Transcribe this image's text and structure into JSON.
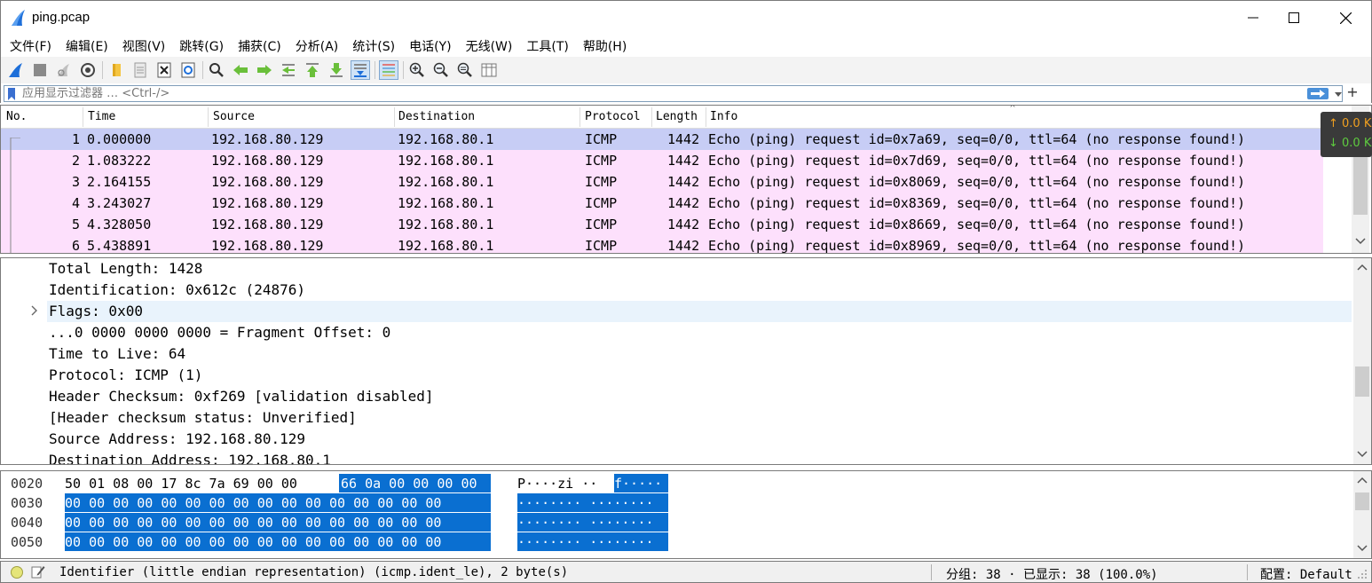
{
  "window": {
    "title": "ping.pcap",
    "app_icon": "wireshark-fin-icon",
    "controls": [
      "minimize-icon",
      "maximize-icon",
      "close-icon"
    ]
  },
  "menu": [
    "文件(F)",
    "编辑(E)",
    "视图(V)",
    "跳转(G)",
    "捕获(C)",
    "分析(A)",
    "统计(S)",
    "电话(Y)",
    "无线(W)",
    "工具(T)",
    "帮助(H)"
  ],
  "toolbar": {
    "icons": [
      "start-capture-icon",
      "stop-capture-icon",
      "restart-capture-icon",
      "capture-options-icon",
      "open-file-icon",
      "save-file-icon",
      "close-file-icon",
      "reload-file-icon",
      "find-packet-icon",
      "go-back-icon",
      "go-forward-icon",
      "go-to-packet-icon",
      "go-first-icon",
      "go-last-icon",
      "auto-scroll-icon",
      "colorize-icon",
      "zoom-in-icon",
      "zoom-out-icon",
      "zoom-normal-icon",
      "resize-columns-icon"
    ]
  },
  "filter": {
    "placeholder": "应用显示过滤器 … <Ctrl-/>"
  },
  "packet_list": {
    "columns": [
      "No.",
      "Time",
      "Source",
      "Destination",
      "Protocol",
      "Length",
      "Info"
    ],
    "rows": [
      {
        "no": "1",
        "time": "0.000000",
        "src": "192.168.80.129",
        "dst": "192.168.80.1",
        "proto": "ICMP",
        "len": "1442",
        "info": "Echo (ping) request  id=0x7a69, seq=0/0, ttl=64 (no response found!)"
      },
      {
        "no": "2",
        "time": "1.083222",
        "src": "192.168.80.129",
        "dst": "192.168.80.1",
        "proto": "ICMP",
        "len": "1442",
        "info": "Echo (ping) request  id=0x7d69, seq=0/0, ttl=64 (no response found!)"
      },
      {
        "no": "3",
        "time": "2.164155",
        "src": "192.168.80.129",
        "dst": "192.168.80.1",
        "proto": "ICMP",
        "len": "1442",
        "info": "Echo (ping) request  id=0x8069, seq=0/0, ttl=64 (no response found!)"
      },
      {
        "no": "4",
        "time": "3.243027",
        "src": "192.168.80.129",
        "dst": "192.168.80.1",
        "proto": "ICMP",
        "len": "1442",
        "info": "Echo (ping) request  id=0x8369, seq=0/0, ttl=64 (no response found!)"
      },
      {
        "no": "5",
        "time": "4.328050",
        "src": "192.168.80.129",
        "dst": "192.168.80.1",
        "proto": "ICMP",
        "len": "1442",
        "info": "Echo (ping) request  id=0x8669, seq=0/0, ttl=64 (no response found!)"
      },
      {
        "no": "6",
        "time": "5.438891",
        "src": "192.168.80.129",
        "dst": "192.168.80.1",
        "proto": "ICMP",
        "len": "1442",
        "info": "Echo (ping) request  id=0x8969, seq=0/0, ttl=64 (no response found!)"
      }
    ],
    "row_colors": {
      "normal": "#fde0fc",
      "selected": "#c7cdf5"
    }
  },
  "traffic_indicator": {
    "up": "↑ 0.0 K",
    "down": "↓ 0.0 K"
  },
  "details": [
    "Total Length: 1428",
    "Identification: 0x612c (24876)",
    "Flags: 0x00",
    "...0 0000 0000 0000 = Fragment Offset: 0",
    "Time to Live: 64",
    "Protocol: ICMP (1)",
    "Header Checksum: 0xf269 [validation disabled]",
    "[Header checksum status: Unverified]",
    "Source Address: 192.168.80.129",
    "Destination Address: 192.168.80.1"
  ],
  "bytes": [
    {
      "offset": "0020",
      "hex_plain": "50 01 08 00 17 8c 7a 69  00 00",
      "hex_sel": "66 0a 00 00 00 00",
      "ascii_plain": "P····zi ··",
      "ascii_sel": "f·····"
    },
    {
      "offset": "0030",
      "hex_plain": "",
      "hex_sel": "00 00 00 00 00 00 00 00  00 00 00 00 00 00 00 00",
      "ascii_plain": "",
      "ascii_sel": "········ ········"
    },
    {
      "offset": "0040",
      "hex_plain": "",
      "hex_sel": "00 00 00 00 00 00 00 00  00 00 00 00 00 00 00 00",
      "ascii_plain": "",
      "ascii_sel": "········ ········"
    },
    {
      "offset": "0050",
      "hex_plain": "",
      "hex_sel": "00 00 00 00 00 00 00 00  00 00 00 00 00 00 00 00",
      "ascii_plain": "",
      "ascii_sel": "········ ········"
    }
  ],
  "status": {
    "message": "Identifier (little endian representation) (icmp.ident_le), 2 byte(s)",
    "packets": "分组: 38 · 已显示: 38 (100.0%)",
    "profile": "配置: Default"
  },
  "colors": {
    "accent": "#0a6fd1",
    "selected_row": "#c7cdf5",
    "icmp_row": "#fde0fc",
    "detail_hl": "#e9f3fc"
  }
}
